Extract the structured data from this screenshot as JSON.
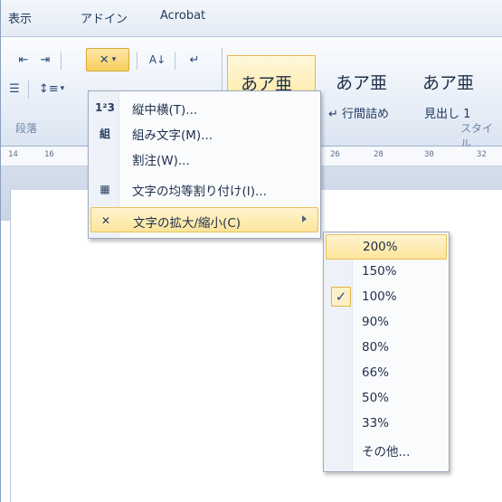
{
  "tabs": [
    "表示",
    "アドイン",
    "Acrobat"
  ],
  "ribbon": {
    "groups": {
      "paragraph": "段落",
      "styles": "スタイル"
    },
    "sort_label": "A↓",
    "styles": [
      {
        "preview": "あア亜",
        "name": ""
      },
      {
        "preview": "あア亜",
        "name": "↵ 行間詰め"
      },
      {
        "preview": "あア亜",
        "name": "見出し 1"
      }
    ]
  },
  "ruler": {
    "ticks": [
      "14",
      "16",
      "26",
      "28",
      "30",
      "32"
    ]
  },
  "menu": {
    "items": [
      {
        "icon": "tate-chu-yoko-icon",
        "glyph": "1²3",
        "label": "縦中横(T)..."
      },
      {
        "icon": "kumimoji-icon",
        "glyph": "組",
        "label": "組み文字(M)..."
      },
      {
        "icon": "",
        "glyph": "",
        "label": "割注(W)..."
      },
      {
        "icon": "char-distribute-icon",
        "glyph": "▦",
        "label": "文字の均等割り付け(I)..."
      },
      {
        "icon": "char-scale-icon",
        "glyph": "✕",
        "label": "文字の拡大/縮小(C)"
      }
    ]
  },
  "submenu": {
    "items": [
      "200%",
      "150%",
      "100%",
      "90%",
      "80%",
      "66%",
      "50%",
      "33%",
      "その他..."
    ],
    "checked": "100%",
    "highlighted": "200%",
    "check_glyph": "✓"
  },
  "colors": {
    "highlight": "#fde49a",
    "accent_text": "#1e395b"
  }
}
